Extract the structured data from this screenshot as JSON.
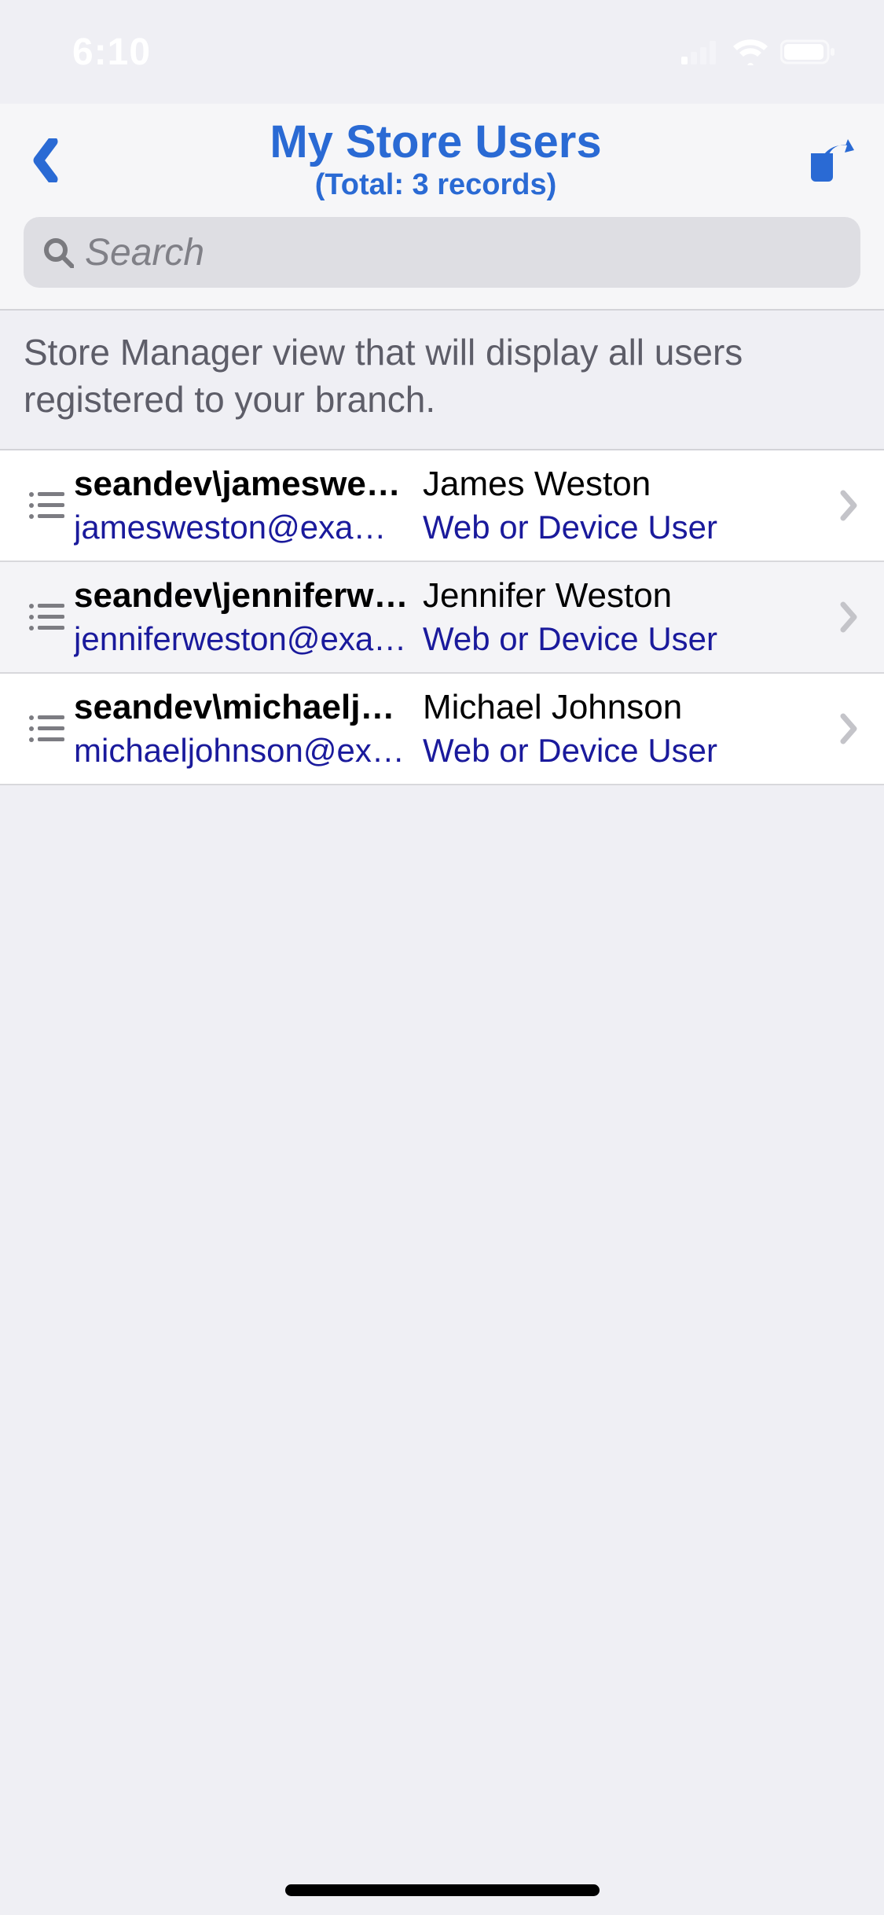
{
  "status": {
    "time": "6:10"
  },
  "nav": {
    "title": "My Store Users",
    "subtitle": "(Total: 3 records)"
  },
  "search": {
    "placeholder": "Search"
  },
  "description": "Store Manager view that will display all users registered to your branch.",
  "users": [
    {
      "username": "seandev\\jamesweston",
      "displayName": "James Weston",
      "email": "jamesweston@example.com",
      "role": "Web or Device User"
    },
    {
      "username": "seandev\\jenniferweston",
      "displayName": "Jennifer Weston",
      "email": "jenniferweston@example.com",
      "role": "Web or Device User"
    },
    {
      "username": "seandev\\michaeljohnson",
      "displayName": "Michael Johnson",
      "email": "michaeljohnson@example.com",
      "role": "Web or Device User"
    }
  ]
}
